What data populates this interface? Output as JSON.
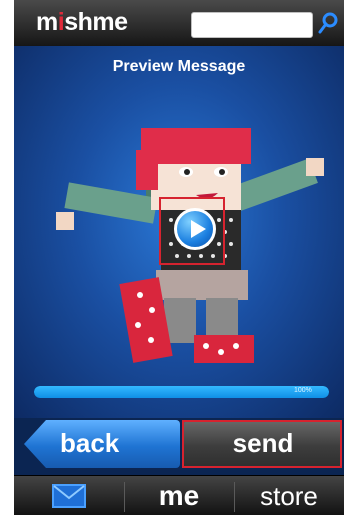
{
  "app": {
    "logo_text": "mishme"
  },
  "search": {
    "placeholder": ""
  },
  "preview": {
    "title": "Preview Message"
  },
  "progress": {
    "value": 100,
    "label": "100%"
  },
  "actions": {
    "back_label": "back",
    "send_label": "send"
  },
  "nav": {
    "items": [
      {
        "label": "",
        "icon": "mail-icon"
      },
      {
        "label": "me"
      },
      {
        "label": "store"
      }
    ]
  },
  "colors": {
    "brand_blue": "#1f74d3",
    "highlight_red": "#d6232f",
    "dark_bar": "#161616"
  }
}
